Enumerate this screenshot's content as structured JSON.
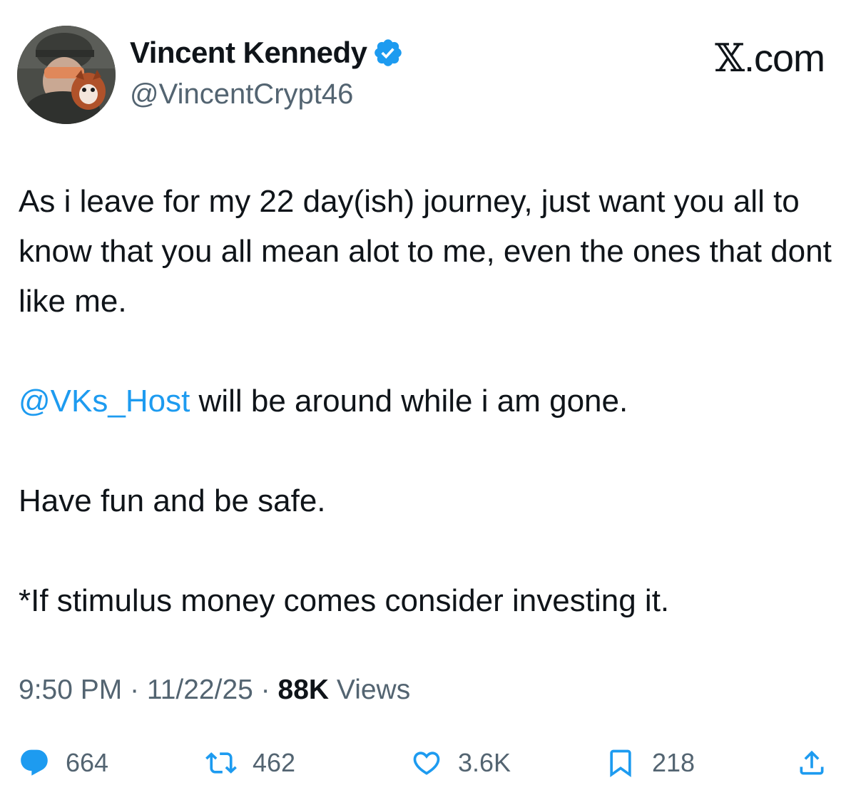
{
  "author": {
    "display_name": "Vincent Kennedy",
    "handle": "@VincentCrypt46",
    "verified": true,
    "verified_color": "#1d9bf0"
  },
  "brand": {
    "x_glyph": "𝕏",
    "suffix": ".com"
  },
  "tweet": {
    "line1": "As i leave for my 22 day(ish) journey, just want you all to know that you all mean alot to me, even the ones that dont like me.",
    "mention": "@VKs_Host",
    "line2_rest": " will be around while i am gone.",
    "line3": "Have fun and be safe.",
    "line4": "*If stimulus money comes consider investing it."
  },
  "meta": {
    "time": "9:50 PM",
    "date": "11/22/25",
    "separator": " · ",
    "views_count": "88K",
    "views_label": " Views"
  },
  "actions": {
    "reply": {
      "icon": "reply-icon",
      "count": "664"
    },
    "repost": {
      "icon": "repost-icon",
      "count": "462"
    },
    "like": {
      "icon": "heart-icon",
      "count": "3.6K"
    },
    "bookmark": {
      "icon": "bookmark-icon",
      "count": "218"
    },
    "share": {
      "icon": "share-icon"
    }
  },
  "colors": {
    "text": "#0f1419",
    "secondary": "#536471",
    "link": "#1d9bf0",
    "icons": "#1d9bf0"
  }
}
